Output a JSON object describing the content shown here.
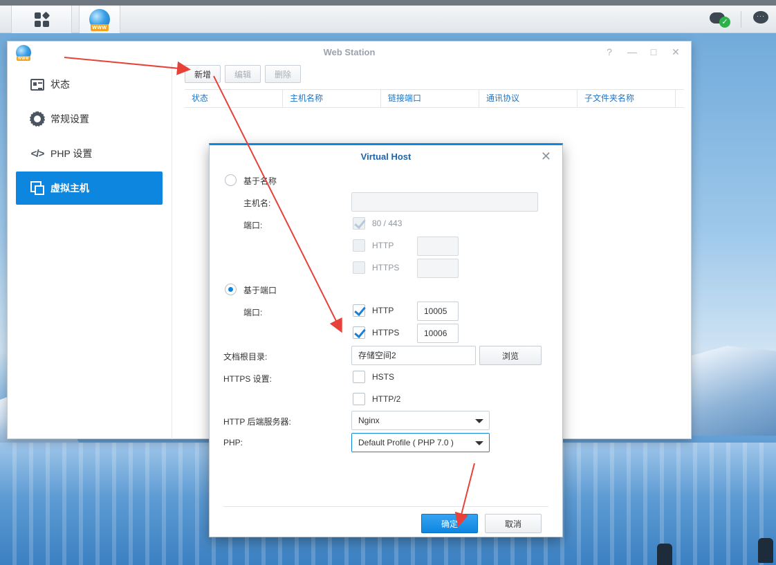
{
  "taskbar": {
    "apps_icon": "apps-grid-icon",
    "app_icon": "web-station-globe-icon",
    "app_icon_text": "WWW",
    "cloud_status_icon": "cloud-sync-ok-icon",
    "chat_icon": "chat-bubble-icon",
    "chat_icon_text": "···"
  },
  "window": {
    "title": "Web Station",
    "controls": {
      "help": "?",
      "minimize": "—",
      "maximize": "□",
      "close": "✕"
    }
  },
  "sidebar": {
    "items": [
      {
        "label": "状态",
        "icon": "status-icon",
        "active": false
      },
      {
        "label": "常规设置",
        "icon": "gear-icon",
        "active": false
      },
      {
        "label": "PHP 设置",
        "icon": "code-icon",
        "active": false
      },
      {
        "label": "虚拟主机",
        "icon": "virtual-host-icon",
        "active": true
      }
    ]
  },
  "toolbar": {
    "add_label": "新增",
    "edit_label": "编辑",
    "delete_label": "删除"
  },
  "grid": {
    "columns": [
      "状态",
      "主机名称",
      "链接端口",
      "通讯协议",
      "子文件夹名称"
    ]
  },
  "dialog": {
    "title": "Virtual Host",
    "close": "✕",
    "name_based": {
      "label": "基于名称",
      "selected": false,
      "hostname_label": "主机名:",
      "hostname_value": "",
      "port_label": "端口:",
      "default_ports_label": "80 / 443",
      "http_label": "HTTP",
      "https_label": "HTTPS",
      "http_value": "",
      "https_value": ""
    },
    "port_based": {
      "label": "基于端口",
      "selected": true,
      "port_label": "端口:",
      "http_label": "HTTP",
      "http_checked": true,
      "http_value": "10005",
      "https_label": "HTTPS",
      "https_checked": true,
      "https_value": "10006"
    },
    "doc_root_label": "文档根目录:",
    "doc_root_value": "存储空间2",
    "browse_label": "浏览",
    "https_settings_label": "HTTPS 设置:",
    "hsts_label": "HSTS",
    "http2_label": "HTTP/2",
    "backend_label": "HTTP 后端服务器:",
    "backend_value": "Nginx",
    "php_label": "PHP:",
    "php_value": "Default Profile ( PHP 7.0 )",
    "ok_label": "确定",
    "cancel_label": "取消"
  },
  "colors": {
    "accent": "#0d86e0",
    "annotation_arrow": "#e8413a",
    "header_text": "#1f74c4"
  }
}
